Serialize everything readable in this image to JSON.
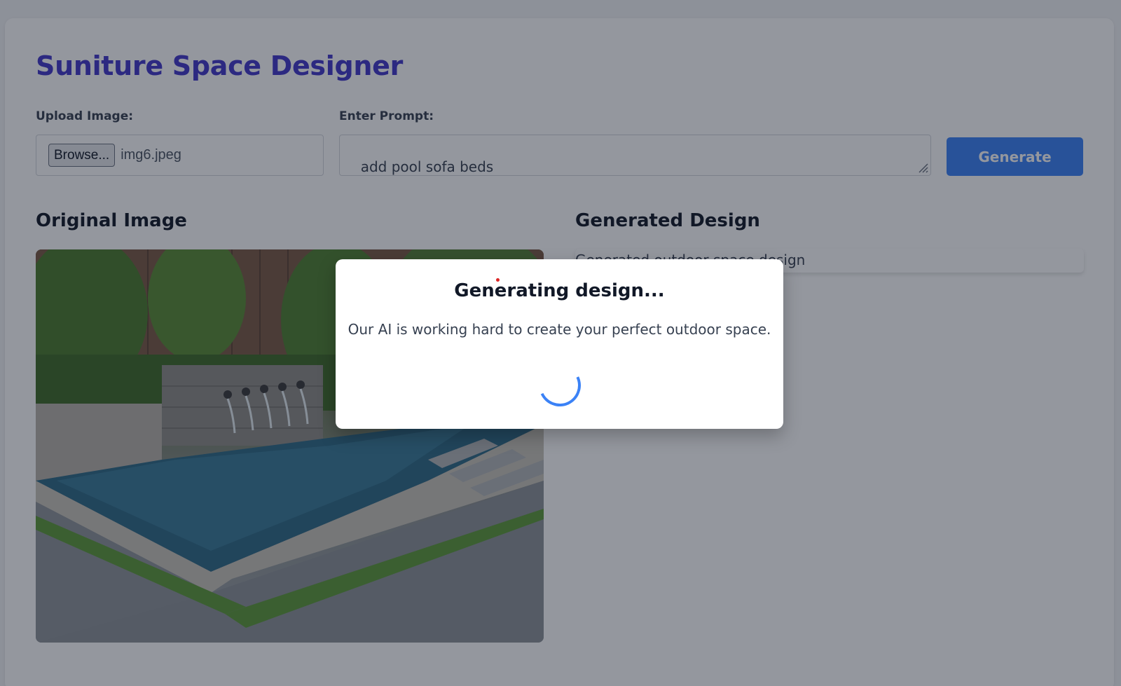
{
  "app": {
    "title": "Suniture Space Designer"
  },
  "upload": {
    "label": "Upload Image:",
    "browse_label": "Browse...",
    "file_name": "img6.jpeg"
  },
  "prompt": {
    "label": "Enter Prompt:",
    "value": "add pool sofa beds\n and stylish umbrellas"
  },
  "generate_button": {
    "label": "Generate"
  },
  "sections": {
    "original_heading": "Original Image",
    "generated_heading": "Generated Design",
    "generated_placeholder": "Generated outdoor space design"
  },
  "modal": {
    "title": "Generating design...",
    "message": "Our AI is working hard to create your perfect outdoor space."
  },
  "colors": {
    "title": "#4338ca",
    "accent": "#3b82f6",
    "overlay": "rgba(17,24,39,0.45)"
  }
}
